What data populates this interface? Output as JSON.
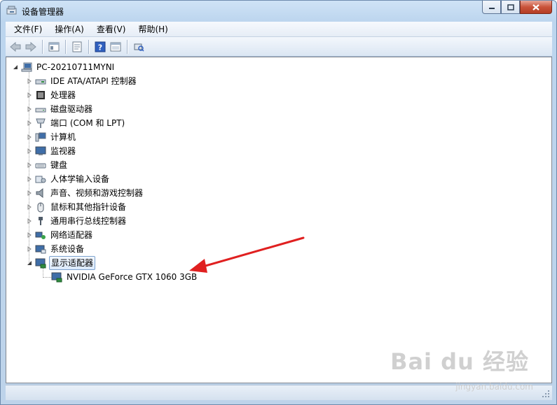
{
  "window": {
    "title": "设备管理器"
  },
  "menu": [
    "文件(F)",
    "操作(A)",
    "查看(V)",
    "帮助(H)"
  ],
  "toolbar": [
    "back-icon",
    "forward-icon",
    "show-hide-tree-icon",
    "properties-icon",
    "help-icon",
    "view-icon",
    "scan-hardware-icon"
  ],
  "tree": {
    "root": "PC-20210711MYNI",
    "categories": [
      {
        "label": "IDE ATA/ATAPI 控制器",
        "icon": "ide-controller-icon"
      },
      {
        "label": "处理器",
        "icon": "processor-icon"
      },
      {
        "label": "磁盘驱动器",
        "icon": "disk-drive-icon"
      },
      {
        "label": "端口 (COM 和 LPT)",
        "icon": "port-icon"
      },
      {
        "label": "计算机",
        "icon": "computer-icon"
      },
      {
        "label": "监视器",
        "icon": "monitor-icon"
      },
      {
        "label": "键盘",
        "icon": "keyboard-icon"
      },
      {
        "label": "人体学输入设备",
        "icon": "hid-icon"
      },
      {
        "label": "声音、视频和游戏控制器",
        "icon": "sound-icon"
      },
      {
        "label": "鼠标和其他指针设备",
        "icon": "mouse-icon"
      },
      {
        "label": "通用串行总线控制器",
        "icon": "usb-icon"
      },
      {
        "label": "网络适配器",
        "icon": "network-adapter-icon"
      },
      {
        "label": "系统设备",
        "icon": "system-device-icon"
      },
      {
        "label": "显示适配器",
        "icon": "display-adapter-icon",
        "expanded": true,
        "selected": true
      }
    ],
    "child": "NVIDIA GeForce GTX 1060 3GB"
  },
  "watermark": {
    "logo": "Bai du 经验",
    "url": "jingyan.baidu.com"
  },
  "colors": {
    "annotation_arrow": "#e02020",
    "selection": "#dceafc"
  }
}
